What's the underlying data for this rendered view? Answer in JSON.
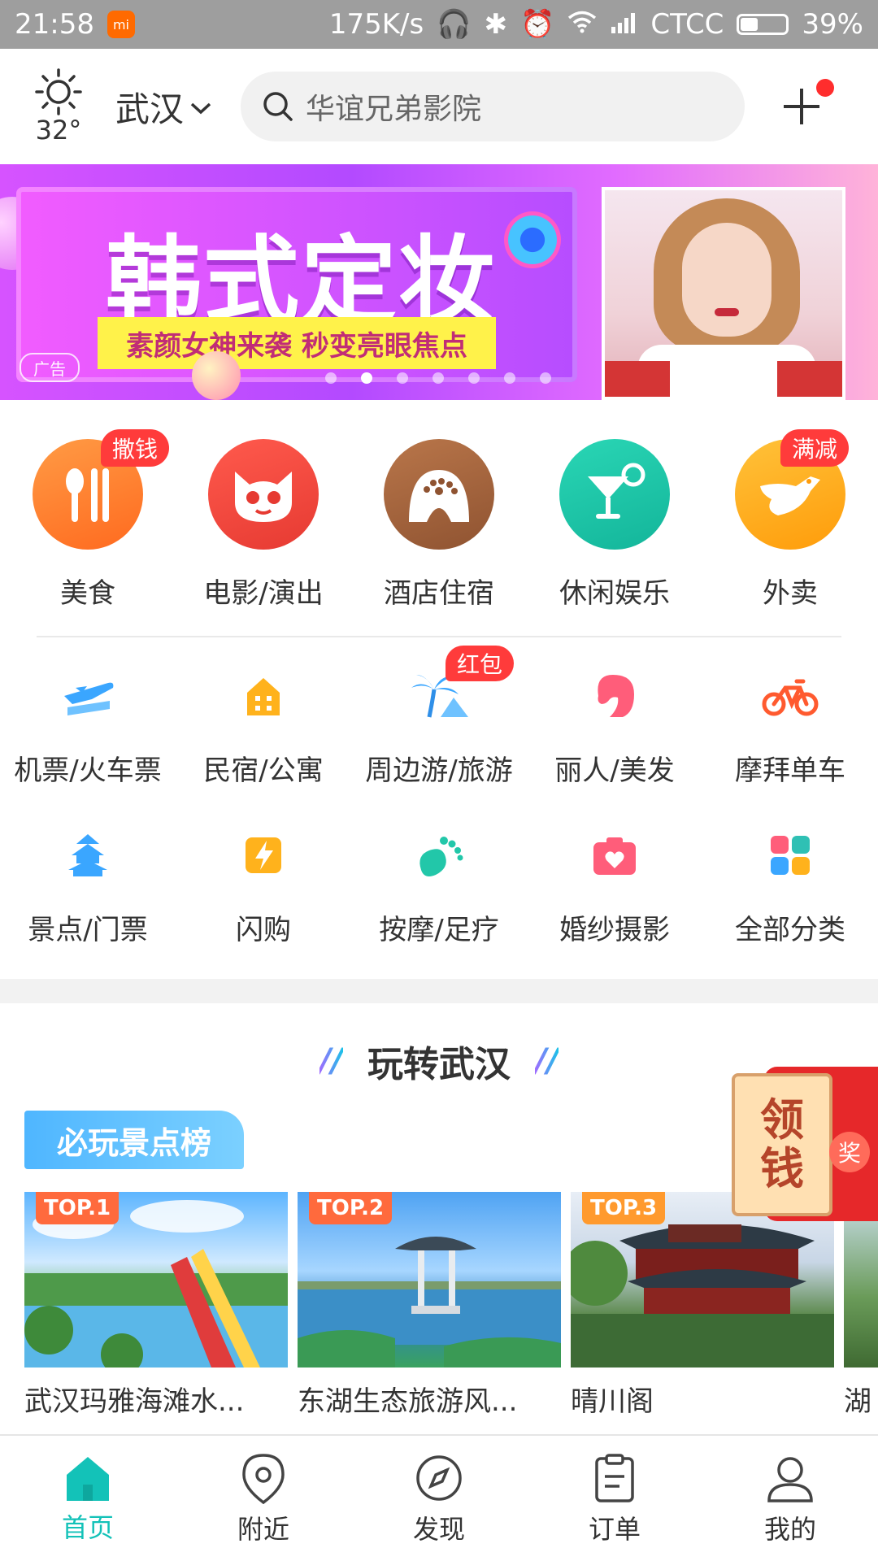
{
  "status_bar": {
    "time": "21:58",
    "speed": "175K/s",
    "carrier": "CTCC",
    "battery": "39%",
    "battery_level": 0.39
  },
  "header": {
    "temperature": "32°",
    "city": "武汉",
    "search_placeholder": "华谊兄弟影院"
  },
  "banner": {
    "headline": "韩式定妆",
    "subline": "素颜女神来袭  秒变亮眼焦点",
    "ad_tag": "广告",
    "dots_count": 7,
    "active_dot": 1
  },
  "main_categories": [
    {
      "label": "美食",
      "badge": "撒钱",
      "color": "#ff7a2f",
      "icon": "utensils-icon"
    },
    {
      "label": "电影/演出",
      "badge": "",
      "color": "#f1473f",
      "icon": "cat-face-icon"
    },
    {
      "label": "酒店住宿",
      "badge": "",
      "color": "#a4633d",
      "icon": "hotel-bed-icon"
    },
    {
      "label": "休闲娱乐",
      "badge": "",
      "color": "#1ec6a7",
      "icon": "cocktail-icon"
    },
    {
      "label": "外卖",
      "badge": "满减",
      "color": "#ffac1c",
      "icon": "kangaroo-icon"
    }
  ],
  "sub_categories": [
    {
      "label": "机票/火车票",
      "badge": "",
      "icon": "plane-train-icon",
      "color": "#3aa6ff"
    },
    {
      "label": "民宿/公寓",
      "badge": "",
      "icon": "house-icon",
      "color": "#ffb21c"
    },
    {
      "label": "周边游/旅游",
      "badge": "红包",
      "icon": "palm-tree-icon",
      "color": "#3aa6ff"
    },
    {
      "label": "丽人/美发",
      "badge": "",
      "icon": "woman-hair-icon",
      "color": "#ff5d7a"
    },
    {
      "label": "摩拜单车",
      "badge": "",
      "icon": "bicycle-icon",
      "color": "#ff5a2f"
    },
    {
      "label": "景点/门票",
      "badge": "",
      "icon": "pagoda-icon",
      "color": "#3aa6ff"
    },
    {
      "label": "闪购",
      "badge": "",
      "icon": "lightning-icon",
      "color": "#ffb21c"
    },
    {
      "label": "按摩/足疗",
      "badge": "",
      "icon": "footprint-icon",
      "color": "#22c7a9"
    },
    {
      "label": "婚纱摄影",
      "badge": "",
      "icon": "camera-heart-icon",
      "color": "#ff5d7a"
    },
    {
      "label": "全部分类",
      "badge": "",
      "icon": "grid-icon",
      "color": "#ff5d7a"
    }
  ],
  "play_section": {
    "title": "玩转武汉",
    "rank_tag": "必玩景点榜",
    "envelope_text_1": "领",
    "envelope_text_2": "钱",
    "envelope_seal": "奖",
    "cards": [
      {
        "top": "TOP.1",
        "name": "武汉玛雅海滩水..."
      },
      {
        "top": "TOP.2",
        "name": "东湖生态旅游风..."
      },
      {
        "top": "TOP.3",
        "name": "晴川阁"
      },
      {
        "top": "",
        "name": "湖"
      }
    ]
  },
  "bottom_nav": [
    {
      "label": "首页",
      "icon": "home-icon",
      "active": true
    },
    {
      "label": "附近",
      "icon": "location-pin-icon",
      "active": false
    },
    {
      "label": "发现",
      "icon": "compass-icon",
      "active": false
    },
    {
      "label": "订单",
      "icon": "order-list-icon",
      "active": false
    },
    {
      "label": "我的",
      "icon": "user-profile-icon",
      "active": false
    }
  ]
}
